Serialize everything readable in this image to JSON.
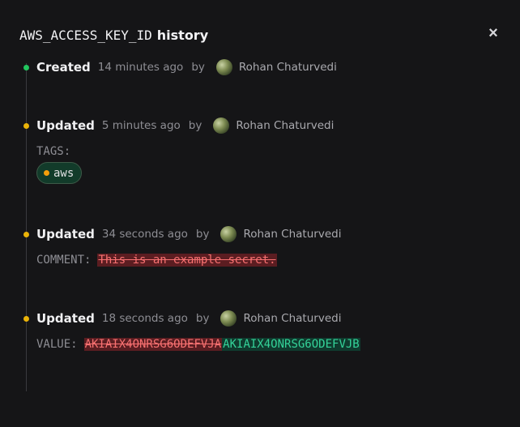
{
  "dialog": {
    "title_key": "AWS_ACCESS_KEY_ID",
    "title_suffix": "history",
    "close_label": "×"
  },
  "entries": [
    {
      "action": "Created",
      "time": "14 minutes ago",
      "by": "by",
      "user": "Rohan Chaturvedi",
      "status_color": "#22c55e"
    },
    {
      "action": "Updated",
      "time": "5 minutes ago",
      "by": "by",
      "user": "Rohan Chaturvedi",
      "status_color": "#eab308",
      "field_label": "TAGS:",
      "tags": [
        {
          "name": "aws",
          "color": "#f59e0b"
        }
      ]
    },
    {
      "action": "Updated",
      "time": "34 seconds ago",
      "by": "by",
      "user": "Rohan Chaturvedi",
      "status_color": "#eab308",
      "field_label": "COMMENT:",
      "removed": "This is an example secret."
    },
    {
      "action": "Updated",
      "time": "18 seconds ago",
      "by": "by",
      "user": "Rohan Chaturvedi",
      "status_color": "#eab308",
      "field_label": "VALUE:",
      "removed": "AKIAIX4ONRSG6ODEFVJA",
      "added": "AKIAIX4ONRSG6ODEFVJB"
    }
  ]
}
